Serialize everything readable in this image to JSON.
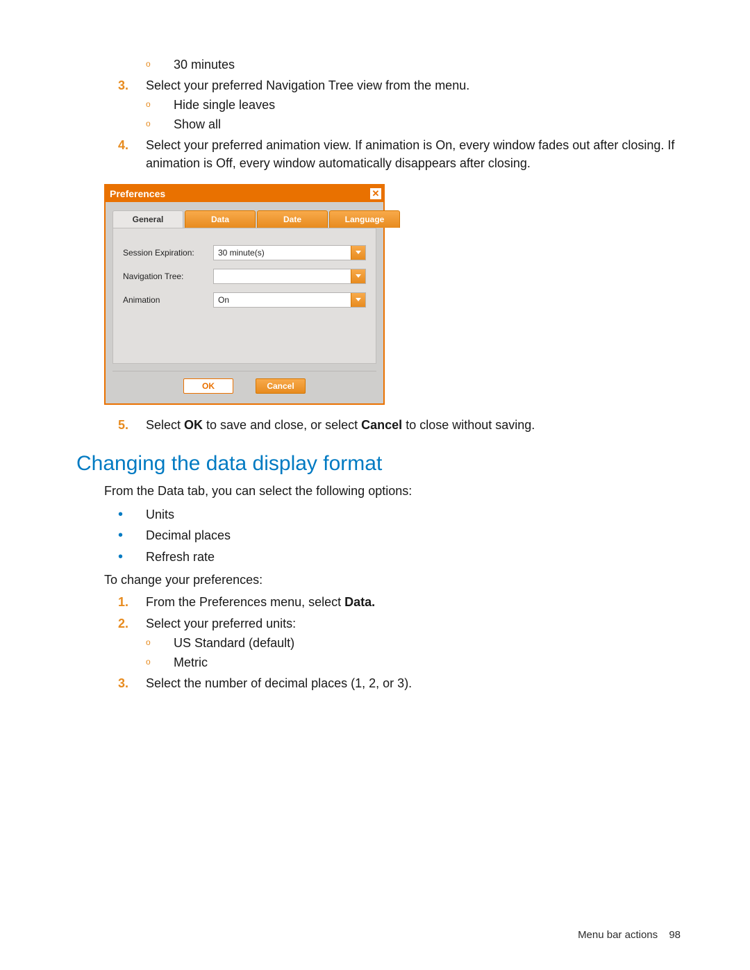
{
  "list_top": {
    "sub_30min": "30 minutes",
    "item3_text": "Select your preferred Navigation Tree view from the menu.",
    "item3_sub_a": "Hide single leaves",
    "item3_sub_b": "Show all",
    "item4_text": "Select your preferred animation view. If animation is On, every window fades out after closing. If animation is Off, every window automatically disappears after closing.",
    "item5_pre": "Select ",
    "item5_bold1": "OK",
    "item5_mid": " to save and close, or select ",
    "item5_bold2": "Cancel",
    "item5_post": " to close without saving."
  },
  "nums": {
    "n3": "3.",
    "n4": "4.",
    "n5": "5.",
    "n1b": "1.",
    "n2b": "2.",
    "n3b": "3."
  },
  "dialog": {
    "title": "Preferences",
    "close_glyph": "✕",
    "tabs": {
      "general": "General",
      "data": "Data",
      "date": "Date",
      "language": "Language"
    },
    "fields": {
      "session_label": "Session Expiration:",
      "session_value": "30 minute(s)",
      "nav_label": "Navigation Tree:",
      "nav_value": "",
      "anim_label": "Animation",
      "anim_value": "On"
    },
    "buttons": {
      "ok": "OK",
      "cancel": "Cancel"
    }
  },
  "section_heading": "Changing the data display format",
  "section_intro": "From the Data tab, you can select the following options:",
  "dot_items": {
    "a": "Units",
    "b": "Decimal places",
    "c": "Refresh rate"
  },
  "change_intro": "To change your preferences:",
  "steps2": {
    "s1_pre": "From the Preferences menu, select ",
    "s1_bold": "Data.",
    "s2_text": "Select your preferred units:",
    "s2_sub_a": "US Standard (default)",
    "s2_sub_b": "Metric",
    "s3_text": "Select the number of decimal places (1, 2, or 3)."
  },
  "footer": {
    "label": "Menu bar actions",
    "page": "98"
  }
}
